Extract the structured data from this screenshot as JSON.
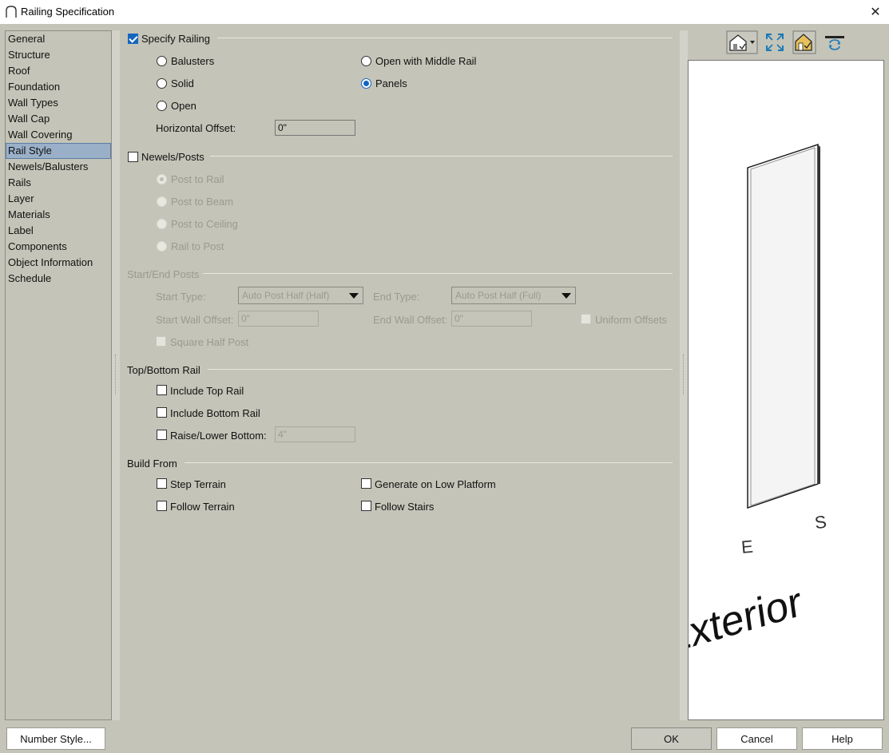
{
  "window": {
    "title": "Railing Specification"
  },
  "nav": {
    "items": [
      "General",
      "Structure",
      "Roof",
      "Foundation",
      "Wall Types",
      "Wall Cap",
      "Wall Covering",
      "Rail Style",
      "Newels/Balusters",
      "Rails",
      "Layer",
      "Materials",
      "Label",
      "Components",
      "Object Information",
      "Schedule"
    ],
    "active_index": 7
  },
  "specify_railing": {
    "label": "Specify Railing",
    "checked": true,
    "options": {
      "balusters": "Balusters",
      "solid": "Solid",
      "open": "Open",
      "open_middle_rail": "Open with Middle Rail",
      "panels": "Panels"
    },
    "selected": "panels",
    "horizontal_offset_label": "Horizontal Offset:",
    "horizontal_offset_value": "0\""
  },
  "newels_posts": {
    "label": "Newels/Posts",
    "checked": false,
    "options": {
      "post_to_rail": "Post to Rail",
      "post_to_beam": "Post to Beam",
      "post_to_ceiling": "Post to Ceiling",
      "rail_to_post": "Rail to Post"
    },
    "selected": "post_to_rail"
  },
  "start_end_posts": {
    "label": "Start/End Posts",
    "start_type_label": "Start Type:",
    "start_type_value": "Auto Post Half (Half)",
    "end_type_label": "End Type:",
    "end_type_value": "Auto Post Half (Full)",
    "start_wall_offset_label": "Start Wall Offset:",
    "start_wall_offset_value": "0\"",
    "end_wall_offset_label": "End Wall Offset:",
    "end_wall_offset_value": "0\"",
    "uniform_offsets_label": "Uniform Offsets",
    "square_half_post_label": "Square Half Post"
  },
  "top_bottom_rail": {
    "label": "Top/Bottom Rail",
    "include_top_rail": "Include Top Rail",
    "include_bottom_rail": "Include Bottom Rail",
    "raise_lower_bottom": "Raise/Lower Bottom:",
    "raise_lower_value": "4\""
  },
  "build_from": {
    "label": "Build From",
    "step_terrain": "Step Terrain",
    "follow_terrain": "Follow Terrain",
    "generate_low_platform": "Generate on Low Platform",
    "follow_stairs": "Follow Stairs"
  },
  "preview": {
    "toolbar_icons": [
      "view-mode-icon",
      "fill-window-icon",
      "house-view-icon",
      "reset-view-icon"
    ],
    "label_e": "E",
    "label_s": "S",
    "label_exterior": "Exterior"
  },
  "buttons": {
    "number_style": "Number Style...",
    "ok": "OK",
    "cancel": "Cancel",
    "help": "Help"
  },
  "colors": {
    "background": "#c4c4b8",
    "accent": "#1565c0",
    "nav_selected": "#9ab0c8"
  }
}
